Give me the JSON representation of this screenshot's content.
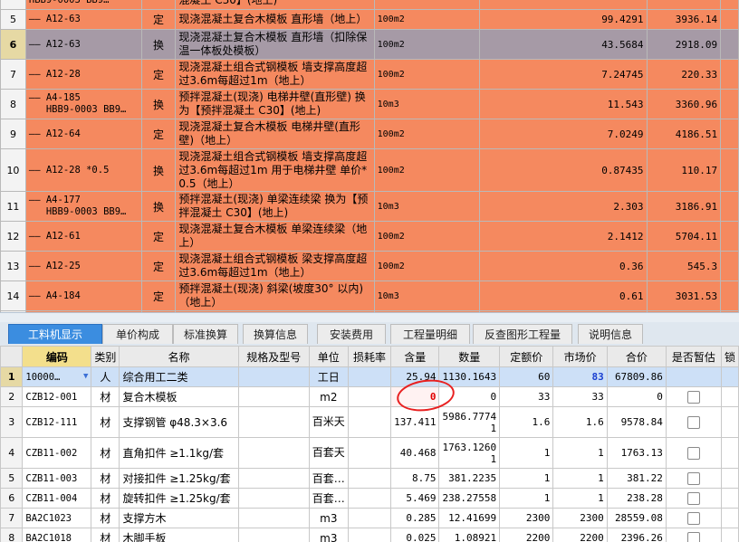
{
  "upper_rows": [
    {
      "row": "",
      "code": "HBB9-0003 BB9…",
      "type": "",
      "name": "混凝土 C30】(地上)",
      "unit": "",
      "qty": "",
      "price": "",
      "h": 20,
      "cls": "orange"
    },
    {
      "row": "5",
      "code": "—— A12-63",
      "type": "定",
      "name": "现浇混凝土复合木模板 直形墙（地上）",
      "unit": "100m2",
      "qty": "99.4291",
      "price": "3936.14",
      "h": 22,
      "cls": "orange"
    },
    {
      "row": "6",
      "code": "—— A12-63",
      "type": "换",
      "name": "现浇混凝土复合木模板 直形墙（扣除保温一体板处模板）",
      "unit": "100m2",
      "qty": "43.5684",
      "price": "2918.09",
      "h": 33,
      "cls": "sel"
    },
    {
      "row": "7",
      "code": "—— A12-28",
      "type": "定",
      "name": "现浇混凝土组合式钢模板 墙支撑高度超过3.6m每超过1m（地上）",
      "unit": "100m2",
      "qty": "7.24745",
      "price": "220.33",
      "h": 33,
      "cls": "orange"
    },
    {
      "row": "8",
      "code": "—— A4-185\n   HBB9-0003 BB9…",
      "type": "换",
      "name": "预拌混凝土(现浇) 电梯井壁(直形壁) 换为【预拌混凝土 C30】(地上)",
      "unit": "10m3",
      "qty": "11.543",
      "price": "3360.96",
      "h": 33,
      "cls": "orange"
    },
    {
      "row": "9",
      "code": "—— A12-64",
      "type": "定",
      "name": "现浇混凝土复合木模板 电梯井壁(直形壁)（地上）",
      "unit": "100m2",
      "qty": "7.0249",
      "price": "4186.51",
      "h": 33,
      "cls": "orange"
    },
    {
      "row": "10",
      "code": "—— A12-28 *0.5",
      "type": "换",
      "name": "现浇混凝土组合式钢模板 墙支撑高度超过3.6m每超过1m 用于电梯井壁 单价*0.5（地上）",
      "unit": "100m2",
      "qty": "0.87435",
      "price": "110.17",
      "h": 47,
      "cls": "orange"
    },
    {
      "row": "11",
      "code": "—— A4-177\n   HBB9-0003 BB9…",
      "type": "换",
      "name": "预拌混凝土(现浇) 单梁连续梁 换为【预拌混凝土 C30】(地上)",
      "unit": "10m3",
      "qty": "2.303",
      "price": "3186.91",
      "h": 33,
      "cls": "orange"
    },
    {
      "row": "12",
      "code": "—— A12-61",
      "type": "定",
      "name": "现浇混凝土复合木模板 单梁连续梁（地上）",
      "unit": "100m2",
      "qty": "2.1412",
      "price": "5704.11",
      "h": 33,
      "cls": "orange"
    },
    {
      "row": "13",
      "code": "—— A12-25",
      "type": "定",
      "name": "现浇混凝土组合式钢模板 梁支撑高度超过3.6m每超过1m（地上）",
      "unit": "100m2",
      "qty": "0.36",
      "price": "545.3",
      "h": 33,
      "cls": "orange"
    },
    {
      "row": "14",
      "code": "—— A4-184",
      "type": "定",
      "name": "预拌混凝土(现浇) 斜梁(坡度30° 以内)（地上）",
      "unit": "10m3",
      "qty": "0.61",
      "price": "3031.53",
      "h": 33,
      "cls": "orange"
    },
    {
      "row": "",
      "code": "",
      "type": "",
      "name": "现浇混凝土组合式钢模板 斜梁(坡",
      "unit": "",
      "qty": "",
      "price": "",
      "h": 20,
      "cls": "orange"
    }
  ],
  "tabs": [
    "工料机显示",
    "单价构成",
    "标准换算",
    "换算信息",
    "安装费用",
    "工程量明细",
    "反查图形工程量",
    "说明信息"
  ],
  "headers": [
    "",
    "编码",
    "类别",
    "名称",
    "规格及型号",
    "单位",
    "损耗率",
    "含量",
    "数量",
    "定额价",
    "市场价",
    "合价",
    "是否暂估",
    "锁"
  ],
  "lower_rows": [
    {
      "row": "1",
      "code": "10000…",
      "type": "人",
      "name": "综合用工二类",
      "spec": "",
      "unit": "工日",
      "loss": "",
      "content": "25.94",
      "qty": "1130.1643",
      "quota": "60",
      "market": "83",
      "total": "67809.86",
      "h": 22,
      "sel": true,
      "check": false
    },
    {
      "row": "2",
      "code": "CZB12-001",
      "type": "材",
      "name": "复合木模板",
      "spec": "",
      "unit": "m2",
      "loss": "",
      "content": "0",
      "qty": "0",
      "quota": "33",
      "market": "33",
      "total": "0",
      "h": 22,
      "sel": false,
      "check": true
    },
    {
      "row": "3",
      "code": "CZB12-111",
      "type": "材",
      "name": "支撑钢管 φ48.3×3.6",
      "spec": "",
      "unit": "百米天",
      "loss": "",
      "content": "137.411",
      "qty": "5986.7774 1",
      "quota": "1.6",
      "market": "1.6",
      "total": "9578.84",
      "h": 34,
      "sel": false,
      "check": true
    },
    {
      "row": "4",
      "code": "CZB11-002",
      "type": "材",
      "name": "直角扣件 ≥1.1kg/套",
      "spec": "",
      "unit": "百套天",
      "loss": "",
      "content": "40.468",
      "qty": "1763.1260 1",
      "quota": "1",
      "market": "1",
      "total": "1763.13",
      "h": 34,
      "sel": false,
      "check": true
    },
    {
      "row": "5",
      "code": "CZB11-003",
      "type": "材",
      "name": "对接扣件 ≥1.25kg/套",
      "spec": "",
      "unit": "百套…",
      "loss": "",
      "content": "8.75",
      "qty": "381.2235",
      "quota": "1",
      "market": "1",
      "total": "381.22",
      "h": 22,
      "sel": false,
      "check": true
    },
    {
      "row": "6",
      "code": "CZB11-004",
      "type": "材",
      "name": "旋转扣件 ≥1.25kg/套",
      "spec": "",
      "unit": "百套…",
      "loss": "",
      "content": "5.469",
      "qty": "238.27558",
      "quota": "1",
      "market": "1",
      "total": "238.28",
      "h": 22,
      "sel": false,
      "check": true
    },
    {
      "row": "7",
      "code": "BA2C1023",
      "type": "材",
      "name": "支撑方木",
      "spec": "",
      "unit": "m3",
      "loss": "",
      "content": "0.285",
      "qty": "12.41699",
      "quota": "2300",
      "market": "2300",
      "total": "28559.08",
      "h": 22,
      "sel": false,
      "check": true
    },
    {
      "row": "8",
      "code": "BA2C1018",
      "type": "材",
      "name": "木脚手板",
      "spec": "",
      "unit": "m3",
      "loss": "",
      "content": "0.025",
      "qty": "1.08921",
      "quota": "2200",
      "market": "2200",
      "total": "2396.26",
      "h": 22,
      "sel": false,
      "check": true
    }
  ]
}
